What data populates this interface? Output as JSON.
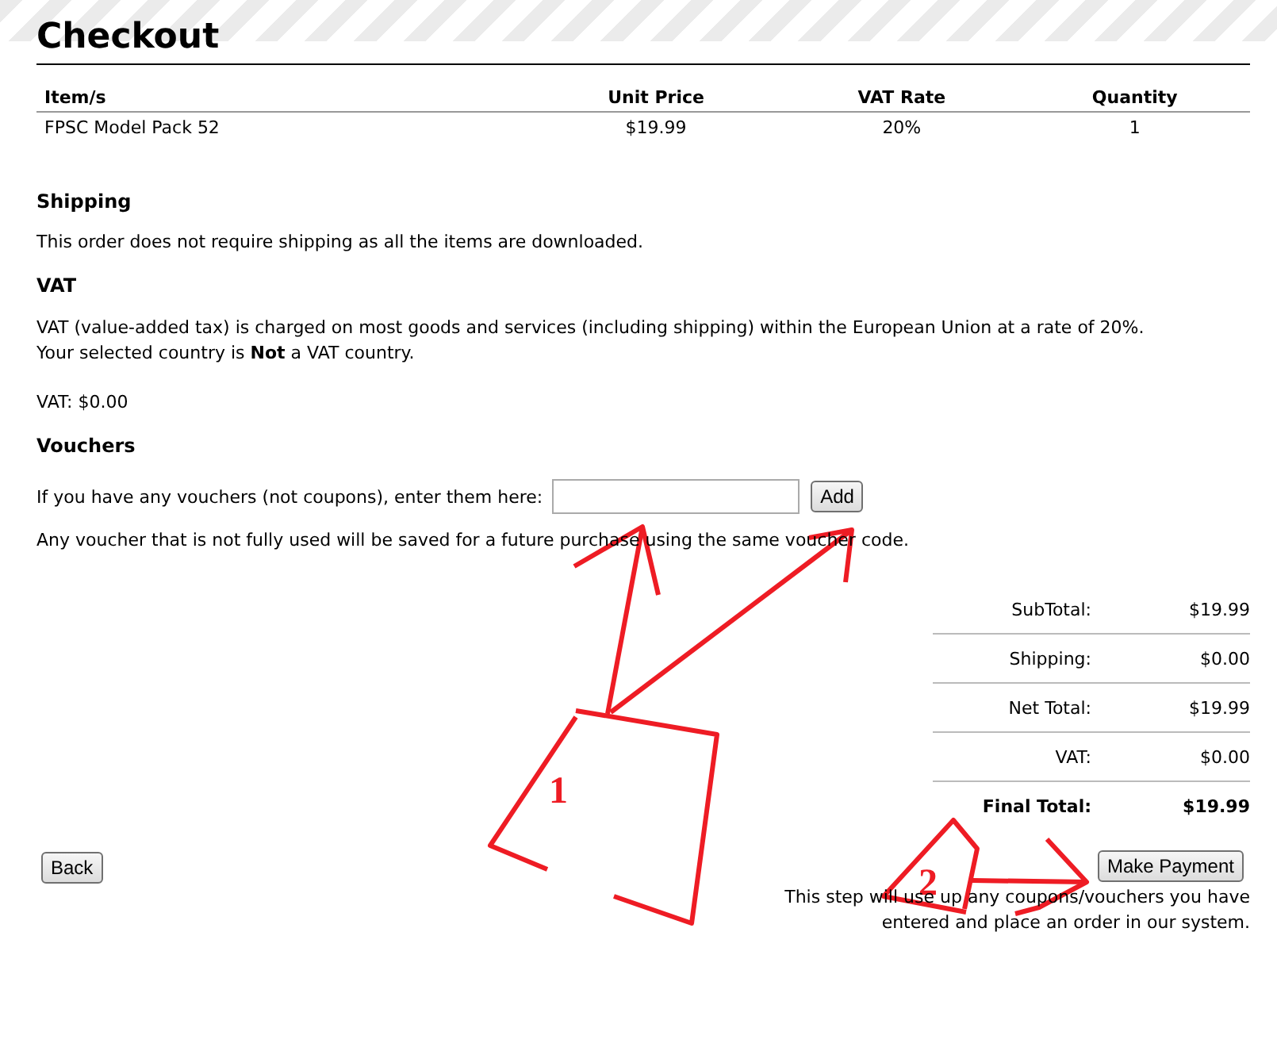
{
  "title": "Checkout",
  "table": {
    "columns": [
      "Item/s",
      "Unit Price",
      "VAT Rate",
      "Quantity"
    ],
    "rows": [
      [
        "FPSC Model Pack 52",
        "$19.99",
        "20%",
        "1"
      ]
    ]
  },
  "shipping": {
    "heading": "Shipping",
    "text": "This order does not require shipping as all the items are downloaded."
  },
  "vat": {
    "heading": "VAT",
    "lines": [
      "VAT (value-added tax) is charged on most goods and services (including shipping) within the European Union at a rate of 20%.",
      "Your selected country is **Not** a VAT country."
    ],
    "amount": "VAT: $0.00"
  },
  "vouchers": {
    "heading": "Vouchers",
    "prompt": "If you have any vouchers (not coupons), enter them here:",
    "add_button": "Add",
    "note": "Any voucher that is not fully used will be saved for a future purchase using the same voucher code."
  },
  "summary": [
    {
      "label": "SubTotal:",
      "value": "$19.99",
      "bold": false
    },
    {
      "label": "Shipping:",
      "value": "$0.00",
      "bold": false
    },
    {
      "label": "Net Total:",
      "value": "$19.99",
      "bold": false
    },
    {
      "label": "VAT:",
      "value": "$0.00",
      "bold": false
    },
    {
      "label": "Final Total:",
      "value": "$19.99",
      "bold": true
    }
  ],
  "back_button": "Back",
  "pay_button": "Make Payment",
  "pay_note": [
    "This step will use up any coupons/vouchers you have",
    "entered and place an order in our system."
  ],
  "annotations": [
    {
      "label": "1"
    },
    {
      "label": "2"
    }
  ]
}
